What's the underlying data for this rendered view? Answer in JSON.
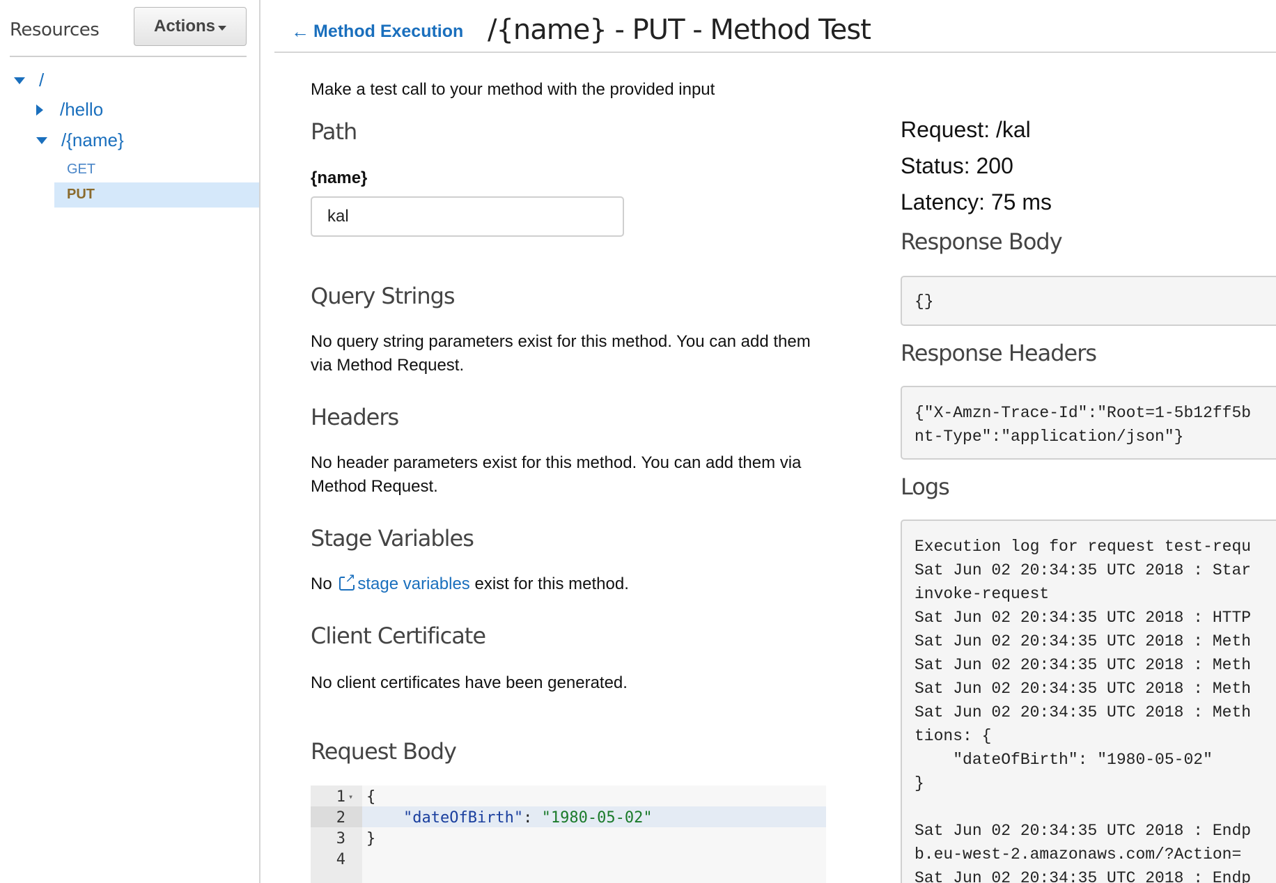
{
  "sidebar": {
    "title": "Resources",
    "actions_label": "Actions",
    "tree": {
      "root": "/",
      "hello": "/hello",
      "name": "/{name}",
      "methods": [
        "GET",
        "PUT"
      ],
      "selected_method": "PUT"
    }
  },
  "header": {
    "back_label": "Method Execution",
    "title": "/{name} - PUT - Method Test"
  },
  "form": {
    "intro": "Make a test call to your method with the provided input",
    "path_title": "Path",
    "param_label": "{name}",
    "param_value": "kal",
    "query_title": "Query Strings",
    "query_text": "No query string parameters exist for this method. You can add them via Method Request.",
    "headers_title": "Headers",
    "headers_text": "No header parameters exist for this method. You can add them via Method Request.",
    "stage_title": "Stage Variables",
    "stage_prefix": "No",
    "stage_link": "stage variables",
    "stage_suffix": "exist for this method.",
    "cert_title": "Client Certificate",
    "cert_text": "No client certificates have been generated.",
    "body_title": "Request Body",
    "editor": {
      "line_numbers": [
        "1",
        "2",
        "3",
        "4"
      ],
      "lines": [
        "{",
        "    \"dateOfBirth\": \"1980-05-02\"",
        "}",
        ""
      ],
      "key": "\"dateOfBirth\"",
      "value": "\"1980-05-02\""
    }
  },
  "result": {
    "request": "Request: /kal",
    "status": "Status: 200",
    "latency": "Latency: 75 ms",
    "response_body_label": "Response Body",
    "response_body": "{}",
    "response_headers_label": "Response Headers",
    "response_headers": "{\"X-Amzn-Trace-Id\":\"Root=1-5b12ff5b\nnt-Type\":\"application/json\"}",
    "logs_label": "Logs",
    "logs": "Execution log for request test-requ\nSat Jun 02 20:34:35 UTC 2018 : Star\ninvoke-request\nSat Jun 02 20:34:35 UTC 2018 : HTTP\nSat Jun 02 20:34:35 UTC 2018 : Meth\nSat Jun 02 20:34:35 UTC 2018 : Meth\nSat Jun 02 20:34:35 UTC 2018 : Meth\nSat Jun 02 20:34:35 UTC 2018 : Meth\ntions: {\n    \"dateOfBirth\": \"1980-05-02\"\n}\n\nSat Jun 02 20:34:35 UTC 2018 : Endp\nb.eu-west-2.amazonaws.com/?Action=\nSat Jun 02 20:34:35 UTC 2018 : Endp"
  },
  "colors": {
    "link": "#1a6fbd",
    "selected_bg": "#d5e8fa",
    "selected_text": "#8a6a2c",
    "code_bg": "#f5f5f5"
  }
}
